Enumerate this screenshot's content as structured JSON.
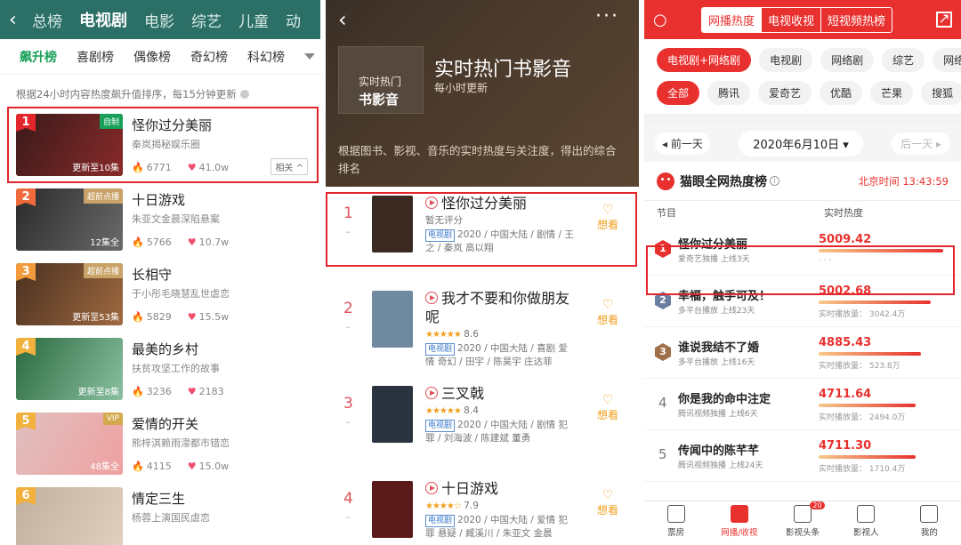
{
  "panel1": {
    "back_icon": "chevron-left-icon",
    "tabs": [
      "总榜",
      "电视剧",
      "电影",
      "综艺",
      "儿童",
      "动"
    ],
    "active_tab": 1,
    "subtabs": [
      "飙升榜",
      "喜剧榜",
      "偶像榜",
      "奇幻榜",
      "科幻榜"
    ],
    "note": "根据24小时内容热度飙升值排序，每15分钟更新",
    "rows": [
      {
        "rank": "1",
        "title": "怪你过分美丽",
        "desc": "秦岚揭秘娱乐圈",
        "fire": "6771",
        "heart": "41.0w",
        "badge": "自制",
        "ep": "更新至10集",
        "related": "相关 ^",
        "rank_color": "#e5252c",
        "badge_color": "#18a058"
      },
      {
        "rank": "2",
        "title": "十日游戏",
        "desc": "朱亚文金晨深陷悬案",
        "fire": "5766",
        "heart": "10.7w",
        "badge": "超前点播",
        "ep": "12集全",
        "rank_color": "#f06a3c",
        "badge_color": "#c8a266"
      },
      {
        "rank": "3",
        "title": "长相守",
        "desc": "于小彤毛晓慧乱世虐恋",
        "fire": "5829",
        "heart": "15.5w",
        "badge": "超前点播",
        "ep": "更新至53集",
        "rank_color": "#f29a3c",
        "badge_color": "#c8a266"
      },
      {
        "rank": "4",
        "title": "最美的乡村",
        "desc": "扶贫攻坚工作的故事",
        "fire": "3236",
        "heart": "2183",
        "badge": "",
        "ep": "更新至8集",
        "rank_color": "#f2b03c",
        "badge_color": ""
      },
      {
        "rank": "5",
        "title": "爱情的开关",
        "desc": "熊梓淇赖雨濛都市错恋",
        "fire": "4115",
        "heart": "15.0w",
        "badge": "VIP",
        "ep": "48集全",
        "rank_color": "#f2b03c",
        "badge_color": "#d4a94c"
      },
      {
        "rank": "6",
        "title": "情定三生",
        "desc": "杨蓉上演国民虐恋",
        "fire": "",
        "heart": "",
        "badge": "",
        "ep": "",
        "rank_color": "#f2b03c",
        "badge_color": ""
      }
    ]
  },
  "panel2": {
    "logo_line1": "实时热门",
    "logo_line2": "书影音",
    "title": "实时热门书影音",
    "subtitle": "每小时更新",
    "desc": "根据图书、影视、音乐的实时热度与关注度，得出的综合排名",
    "want_label": "想看",
    "items": [
      {
        "rank": "1",
        "rank_sub": "–",
        "title": "怪你过分美丽",
        "rating": "暂无评分",
        "stars": "",
        "tag": "电视剧",
        "meta": "2020 / 中国大陆 / 剧情 / 王之 / 秦岚 高以翔",
        "poster": "#3a2a22"
      },
      {
        "rank": "2",
        "rank_sub": "–",
        "title": "我才不要和你做朋友呢",
        "rating": "8.6",
        "stars": "★★★★★",
        "tag": "电视剧",
        "meta": "2020 / 中国大陆 / 喜剧 爱情 奇幻 / 田宇 / 陈昊宇 庄达菲",
        "poster": "#6f8aa0"
      },
      {
        "rank": "3",
        "rank_sub": "–",
        "title": "三叉戟",
        "rating": "8.4",
        "stars": "★★★★★",
        "tag": "电视剧",
        "meta": "2020 / 中国大陆 / 剧情 犯罪 / 刘海波 / 陈建斌 董勇",
        "poster": "#2a3440"
      },
      {
        "rank": "4",
        "rank_sub": "–",
        "title": "十日游戏",
        "rating": "7.9",
        "stars": "★★★★☆",
        "tag": "电视剧",
        "meta": "2020 / 中国大陆 / 爱情 犯罪 悬疑 / 臧溪川 / 朱亚文 金晨",
        "poster": "#5a1a1a"
      }
    ]
  },
  "panel3": {
    "tabs": [
      "网播热度",
      "电视收视",
      "短视频热榜"
    ],
    "active_tab": 0,
    "chips1": [
      "电视剧+网络剧",
      "电视剧",
      "网络剧",
      "综艺",
      "网络电"
    ],
    "chips2": [
      "全部",
      "腾讯",
      "爱奇艺",
      "优酷",
      "芒果",
      "搜狐"
    ],
    "prev_day": "◂ 前一天",
    "date": "2020年6月10日 ▾",
    "next_day": "后一天 ▸",
    "board_title": "猫眼全网热度榜",
    "info": "i",
    "beijing_time": "北京时间 13:43:59",
    "col1": "节目",
    "col2": "实时热度",
    "rows": [
      {
        "rank": "1",
        "name": "怪你过分美丽",
        "sub": "爱奇艺独播 上线3天",
        "value": "5009.42",
        "play": "· · ·",
        "bar": 1.0,
        "hex": "#e8312f"
      },
      {
        "rank": "2",
        "name": "幸福，触手可及！",
        "sub": "多平台播放 上线23天",
        "value": "5002.68",
        "play": "实时播放量： 3042.4万",
        "bar": 0.9,
        "hex": "#6a7fa0"
      },
      {
        "rank": "3",
        "name": "谁说我结不了婚",
        "sub": "多平台播放 上线16天",
        "value": "4885.43",
        "play": "实时播放量： 523.8万",
        "bar": 0.82,
        "hex": "#a0704a"
      },
      {
        "rank": "4",
        "name": "你是我的命中注定",
        "sub": "腾讯视频独播 上线6天",
        "value": "4711.64",
        "play": "实时播放量： 2494.0万",
        "bar": 0.78,
        "hex": ""
      },
      {
        "rank": "5",
        "name": "传闻中的陈芊芊",
        "sub": "腾讯视频独播 上线24天",
        "value": "4711.30",
        "play": "实时播放量： 1710.4万",
        "bar": 0.78,
        "hex": ""
      }
    ],
    "nav": [
      {
        "label": "票房",
        "icon": "calendar-icon"
      },
      {
        "label": "网播/收视",
        "icon": "play-icon"
      },
      {
        "label": "影视头条",
        "icon": "news-icon",
        "badge": "20"
      },
      {
        "label": "影视人",
        "icon": "person-icon"
      },
      {
        "label": "我的",
        "icon": "profile-icon"
      }
    ],
    "active_nav": 1
  }
}
